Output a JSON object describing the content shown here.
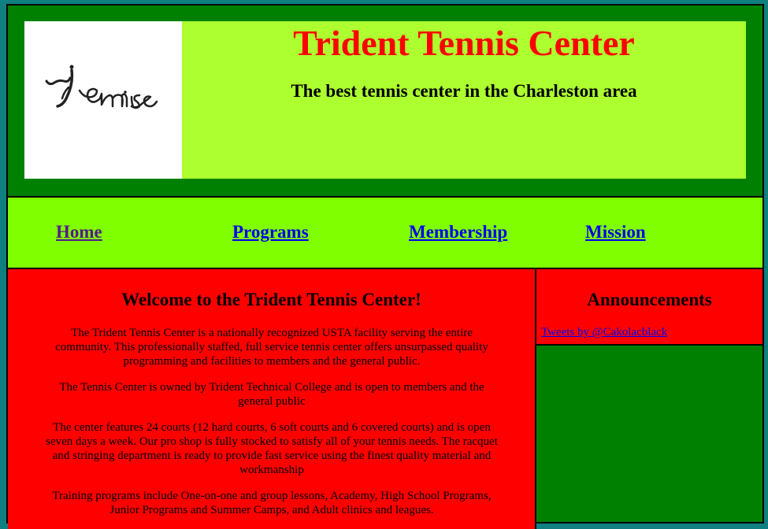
{
  "header": {
    "title": "Trident Tennis Center",
    "subtitle": "The best tennis center in the Charleston area",
    "logo_text": "Tennis"
  },
  "nav": {
    "items": [
      {
        "label": "Home"
      },
      {
        "label": "Programs"
      },
      {
        "label": "Membership"
      },
      {
        "label": "Mission"
      }
    ]
  },
  "main": {
    "heading": "Welcome to the Trident Tennis Center!",
    "paragraphs": [
      "The Trident Tennis Center is a nationally recognized USTA facility serving the entire community. This professionally staffed, full service tennis center offers unsurpassed quality programming and facilities to members and the general public.",
      "The Tennis Center is owned by Trident Technical College and is open to members and the general public",
      "The center features 24 courts (12 hard courts, 6 soft courts and 6 covered courts) and is open seven days a week. Our pro shop is fully stocked to satisfy all of your tennis needs. The racquet and stringing department is ready to provide fast service using the finest quality material and workmanship",
      "Training programs include One-on-one and group lessons, Academy, High School Programs, Junior Programs and Summer Camps, and Adult clinics and leagues."
    ]
  },
  "aside": {
    "heading": "Announcements",
    "link": "Tweets by @Cakolacblack"
  },
  "colors": {
    "page_bg": "#0f7f7f",
    "header_bg": "#008000",
    "header_panel": "#adff2f",
    "nav_bg": "#7fff00",
    "content_bg": "#ff0000",
    "title": "#ff0000"
  }
}
